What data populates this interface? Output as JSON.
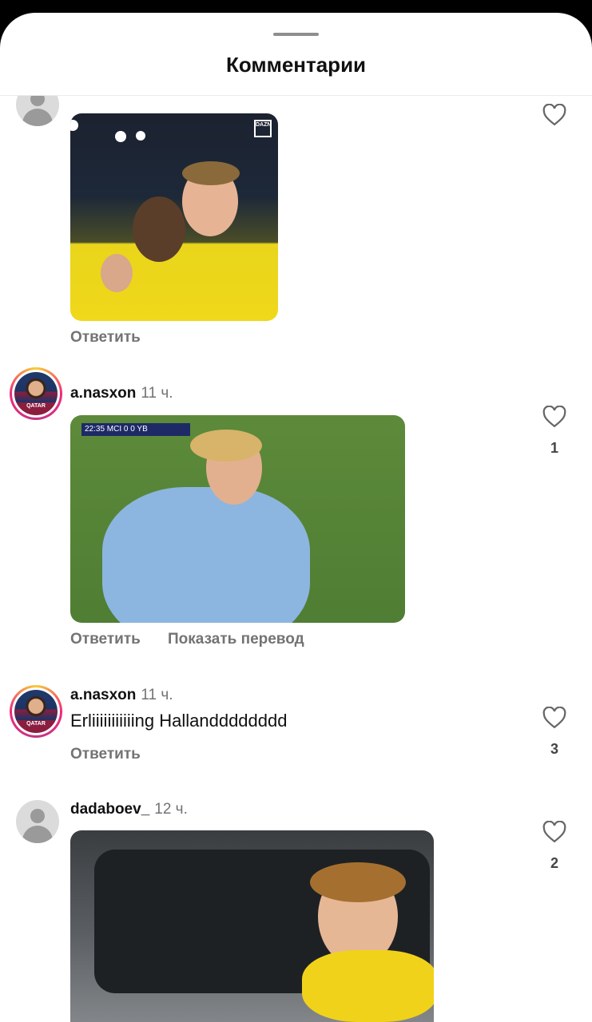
{
  "sheet": {
    "title": "Комментарии"
  },
  "comments": [
    {
      "reply": "Ответить",
      "has_like": true
    },
    {
      "username": "a.nasxon",
      "time": "11 ч.",
      "reply": "Ответить",
      "translate": "Показать перевод",
      "likes": "1"
    },
    {
      "username": "a.nasxon",
      "time": "11 ч.",
      "text": "Erliiiiiiiiiiing Hallandddddddd",
      "reply": "Ответить",
      "likes": "3"
    },
    {
      "username": "dadaboev_",
      "time": "12 ч.",
      "likes": "2"
    }
  ],
  "avatar_badge": "QATAR",
  "gif_overlays": {
    "scoreboard": "22:35  MCI 0 0 YB",
    "watermark": "DAZN"
  },
  "colors": {
    "background": "#ffffff",
    "muted": "#737373",
    "text": "#111111"
  }
}
